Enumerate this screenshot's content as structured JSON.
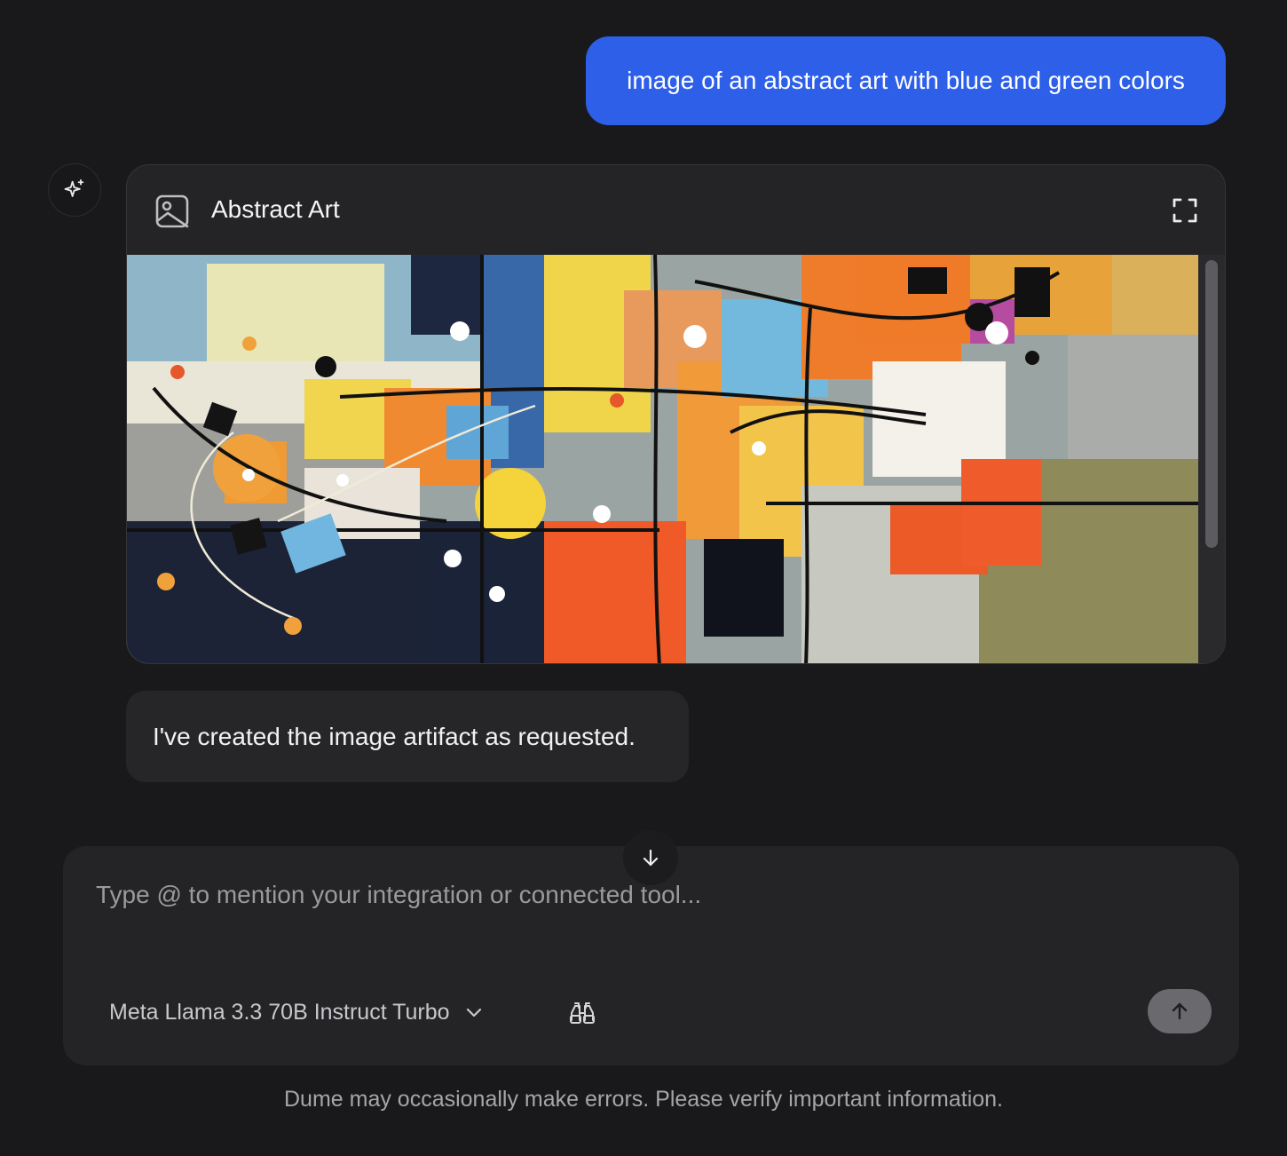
{
  "conversation": {
    "user_message": "image of an abstract art with blue and green colors",
    "artifact": {
      "icon": "image-icon",
      "title": "Abstract Art",
      "expand_icon": "expand-icon"
    },
    "assistant_message": "I've created the image artifact as requested."
  },
  "assistant_avatar_icon": "sparkle-icon",
  "composer": {
    "placeholder": "Type @ to mention your integration or connected tool...",
    "value": "",
    "model_label": "Meta Llama 3.3 70B Instruct Turbo",
    "model_dropdown_icon": "chevron-down-icon",
    "tool_icon": "binoculars-icon",
    "send_icon": "arrow-up-icon",
    "scroll_icon": "arrow-down-icon"
  },
  "footer": {
    "disclaimer": "Dume may occasionally make errors. Please verify important information."
  },
  "colors": {
    "background": "#19191b",
    "user_bubble": "#2d5fe8",
    "surface": "#242426",
    "send_button": "#6a6a6e"
  }
}
